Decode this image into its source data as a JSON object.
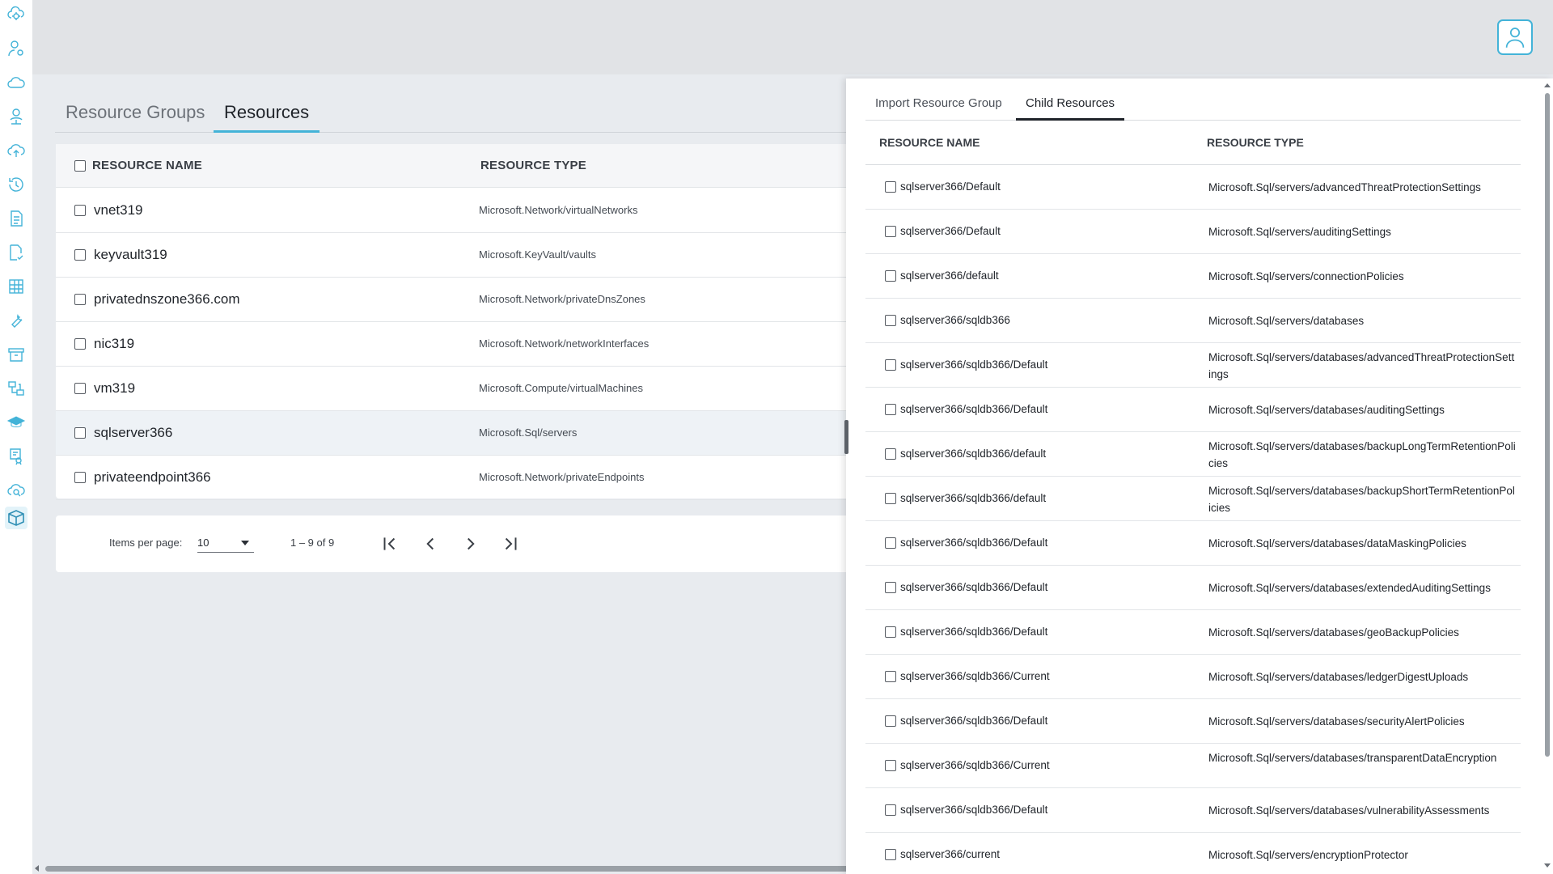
{
  "accent_color": "#43b3d8",
  "rail": {
    "icons": [
      "cloud-gear-icon",
      "user-gear-icon",
      "cloud-icon",
      "user-network-icon",
      "cloud-upload-icon",
      "history-icon",
      "document-icon",
      "document-check-icon",
      "report-grid-icon",
      "wrench-icon",
      "archive-box-icon",
      "migrate-icon",
      "graduation-cap-icon",
      "certificate-icon",
      "cloud-search-icon",
      "package-icon"
    ]
  },
  "header": {
    "user_icon": "user-icon"
  },
  "tabs": [
    "Resource Groups",
    "Resources"
  ],
  "resources_table": {
    "columns": [
      "RESOURCE NAME",
      "RESOURCE TYPE"
    ],
    "rows": [
      {
        "name": "vnet319",
        "type": "Microsoft.Network/virtualNetworks"
      },
      {
        "name": "keyvault319",
        "type": "Microsoft.KeyVault/vaults"
      },
      {
        "name": "privatednszone366.com",
        "type": "Microsoft.Network/privateDnsZones"
      },
      {
        "name": "nic319",
        "type": "Microsoft.Network/networkInterfaces"
      },
      {
        "name": "vm319",
        "type": "Microsoft.Compute/virtualMachines"
      },
      {
        "name": "sqlserver366",
        "type": "Microsoft.Sql/servers"
      },
      {
        "name": "privateendpoint366",
        "type": "Microsoft.Network/privateEndpoints"
      }
    ]
  },
  "paginator": {
    "items_per_page_label": "Items per page:",
    "items_per_page_value": "10",
    "range_label": "1 – 9 of 9"
  },
  "panel": {
    "tabs": [
      "Import Resource Group",
      "Child Resources"
    ],
    "columns": [
      "RESOURCE NAME",
      "RESOURCE TYPE"
    ],
    "rows": [
      {
        "name": "sqlserver366/Default",
        "type": "Microsoft.Sql/servers/advancedThreatProtectionSettings"
      },
      {
        "name": "sqlserver366/Default",
        "type": "Microsoft.Sql/servers/auditingSettings"
      },
      {
        "name": "sqlserver366/default",
        "type": "Microsoft.Sql/servers/connectionPolicies"
      },
      {
        "name": "sqlserver366/sqldb366",
        "type": "Microsoft.Sql/servers/databases"
      },
      {
        "name": "sqlserver366/sqldb366/Default",
        "type": "Microsoft.Sql/servers/databases/advancedThreatProtectionSettings"
      },
      {
        "name": "sqlserver366/sqldb366/Default",
        "type": "Microsoft.Sql/servers/databases/auditingSettings"
      },
      {
        "name": "sqlserver366/sqldb366/default",
        "type": "Microsoft.Sql/servers/databases/backupLongTermRetentionPolicies"
      },
      {
        "name": "sqlserver366/sqldb366/default",
        "type": "Microsoft.Sql/servers/databases/backupShortTermRetentionPolicies"
      },
      {
        "name": "sqlserver366/sqldb366/Default",
        "type": "Microsoft.Sql/servers/databases/dataMaskingPolicies"
      },
      {
        "name": "sqlserver366/sqldb366/Default",
        "type": "Microsoft.Sql/servers/databases/extendedAuditingSettings"
      },
      {
        "name": "sqlserver366/sqldb366/Default",
        "type": "Microsoft.Sql/servers/databases/geoBackupPolicies"
      },
      {
        "name": "sqlserver366/sqldb366/Current",
        "type": "Microsoft.Sql/servers/databases/ledgerDigestUploads"
      },
      {
        "name": "sqlserver366/sqldb366/Default",
        "type": "Microsoft.Sql/servers/databases/securityAlertPolicies"
      },
      {
        "name": "sqlserver366/sqldb366/Current",
        "type": "Microsoft.Sql/servers/databases/transparentDataEncryption"
      },
      {
        "name": "sqlserver366/sqldb366/Default",
        "type": "Microsoft.Sql/servers/databases/vulnerabilityAssessments"
      },
      {
        "name": "sqlserver366/current",
        "type": "Microsoft.Sql/servers/encryptionProtector"
      }
    ]
  }
}
